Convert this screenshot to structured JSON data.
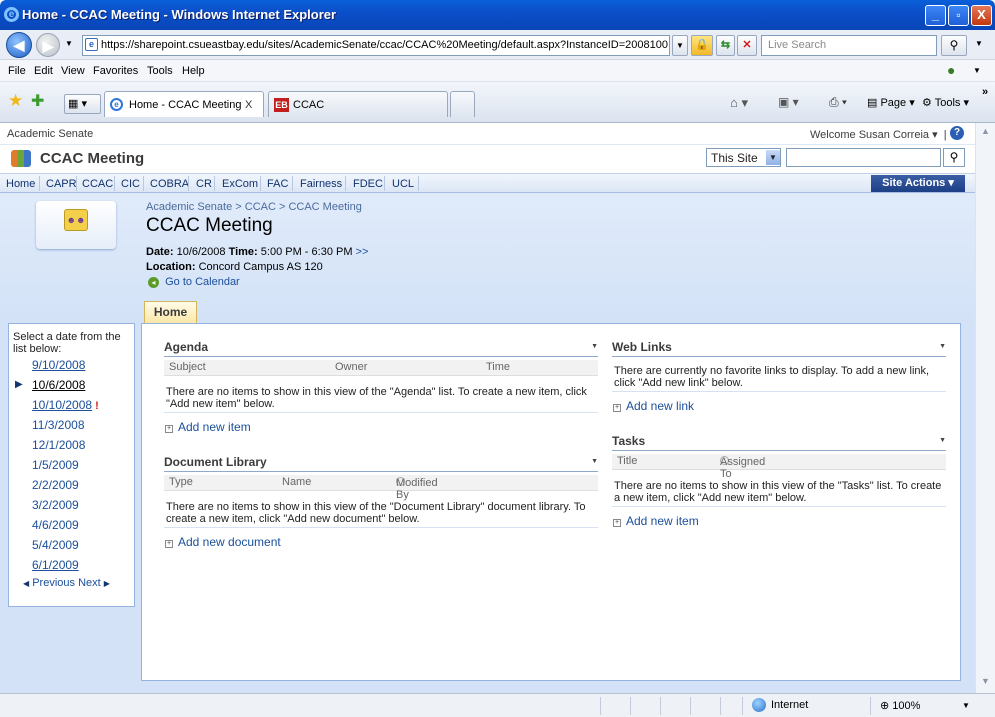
{
  "window": {
    "title": "Home - CCAC Meeting - Windows Internet Explorer",
    "minimize": "_",
    "maximize": "▫",
    "close": "X"
  },
  "browser": {
    "url": "https://sharepoint.csueastbay.edu/sites/AcademicSenate/ccac/CCAC%20Meeting/default.aspx?InstanceID=2008100",
    "search_placeholder": "Live Search",
    "menu": [
      "File",
      "Edit",
      "View",
      "Favorites",
      "Tools",
      "Help"
    ],
    "tabs": [
      {
        "label": "Home - CCAC Meeting",
        "close": "X"
      },
      {
        "label": "CCAC"
      }
    ],
    "toolbar": {
      "page": "Page",
      "tools": "Tools"
    }
  },
  "sharepoint": {
    "site_crumb": "Academic Senate",
    "welcome": "Welcome Susan Correia",
    "site_title": "CCAC Meeting",
    "search_scope": "This Site",
    "nav": [
      "Home",
      "CAPR",
      "CCAC",
      "CIC",
      "COBRA",
      "CR",
      "ExCom",
      "FAC",
      "Fairness",
      "FDEC",
      "UCL"
    ],
    "site_actions": "Site Actions",
    "breadcrumb": "Academic Senate > CCAC > CCAC Meeting",
    "page_title": "CCAC Meeting",
    "date_label": "Date:",
    "date_value": "10/6/2008",
    "time_label": "Time:",
    "time_value": "5:00 PM - 6:30 PM",
    "more": ">>",
    "location_label": "Location:",
    "location_value": "Concord Campus AS 120",
    "go_calendar": "Go to Calendar",
    "page_tab": "Home"
  },
  "leftnav": {
    "intro": "Select a date from the list below:",
    "dates": [
      "9/10/2008",
      "10/6/2008",
      "10/10/2008",
      "11/3/2008",
      "12/1/2008",
      "1/5/2009",
      "2/2/2009",
      "3/2/2009",
      "4/6/2009",
      "5/4/2009",
      "6/1/2009"
    ],
    "selected_index": 1,
    "flagged_index": 2,
    "previous": "Previous",
    "next": "Next"
  },
  "agenda": {
    "title": "Agenda",
    "columns": [
      "Subject",
      "Owner",
      "Time"
    ],
    "empty": "There are no items to show in this view of the \"Agenda\" list. To create a new item, click \"Add new item\" below.",
    "add": "Add new item"
  },
  "doclib": {
    "title": "Document Library",
    "columns": [
      "Type",
      "Name",
      "Modified By"
    ],
    "empty": "There are no items to show in this view of the \"Document Library\" document library. To create a new item, click \"Add new document\" below.",
    "add": "Add new document"
  },
  "weblinks": {
    "title": "Web Links",
    "empty": "There are currently no favorite links to display. To add a new link, click \"Add new link\" below.",
    "add": "Add new link"
  },
  "tasks": {
    "title": "Tasks",
    "columns": [
      "Title",
      "Assigned To"
    ],
    "empty": "There are no items to show in this view of the \"Tasks\" list. To create a new item, click \"Add new item\" below.",
    "add": "Add new item"
  },
  "status": {
    "zone": "Internet",
    "zoom": "100%"
  },
  "colors": {
    "link": "#1a4f9b",
    "title_bar": "#0b4fc9",
    "sp_band": "#d3e2f7",
    "site_actions": "#1c3f86"
  }
}
